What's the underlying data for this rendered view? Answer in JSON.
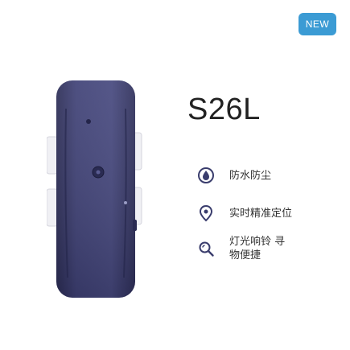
{
  "badge": {
    "label": "NEW",
    "color": "#3b9bd4"
  },
  "product": {
    "model": "S26L"
  },
  "features": [
    {
      "icon": "water-droplet-circle-icon",
      "label": "防水防尘"
    },
    {
      "icon": "location-pin-icon",
      "label": "实时精准定位"
    },
    {
      "icon": "search-magnifier-icon",
      "label": "灯光响铃 寻物便捷"
    }
  ],
  "colors": {
    "device": "#3d3f72",
    "device_dark": "#2c2d57",
    "icon": "#3a3d6d"
  }
}
